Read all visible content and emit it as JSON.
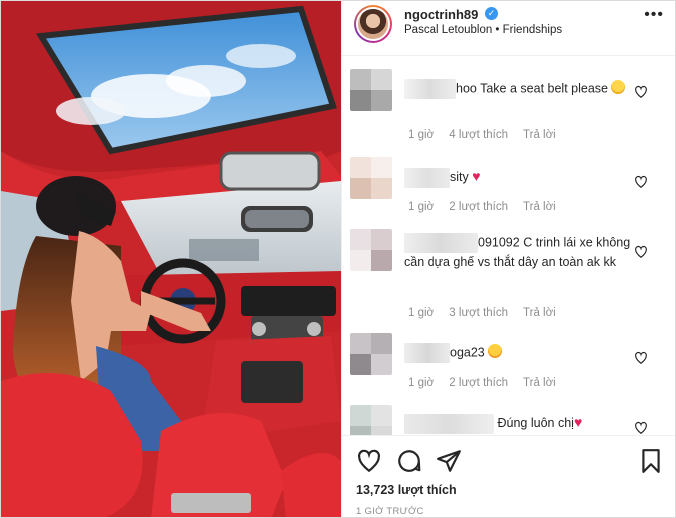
{
  "post": {
    "username": "ngoctrinh89",
    "verified_mark": "✓",
    "music": "Pascal Letoublon • Friendships",
    "more_label": "•••",
    "likes": "13,723 lượt thích",
    "time": "1 GIỜ TRƯỚC"
  },
  "comments": [
    {
      "name_suffix": "hoo",
      "text": "Take a seat belt please",
      "emoji": "smirk-emoji",
      "time": "1 giờ",
      "likes": "4 lượt thích",
      "reply": "Trả lời"
    },
    {
      "name_suffix": "sity",
      "text": "",
      "emoji": "red-heart-emoji",
      "time": "1 giờ",
      "likes": "2 lượt thích",
      "reply": "Trả lời"
    },
    {
      "name_suffix": "091092",
      "text": "C trinh lái xe không cần dựa ghế vs thắt dây an toàn ak kk",
      "emoji": "",
      "time": "1 giờ",
      "likes": "3 lượt thích",
      "reply": "Trả lời"
    },
    {
      "name_suffix": "oga23",
      "text": "",
      "emoji": "star-struck-emoji",
      "time": "1 giờ",
      "likes": "2 lượt thích",
      "reply": "Trả lời"
    },
    {
      "name_suffix": "",
      "text": "Đúng luôn chị",
      "emoji": "red-heart-emoji",
      "time": "",
      "likes": "",
      "reply": ""
    }
  ],
  "icons": {
    "like": "heart-icon",
    "comment": "comment-icon",
    "share": "paper-plane-icon",
    "save": "bookmark-icon"
  },
  "colors": {
    "interior_red": "#d72b31",
    "verified_blue": "#3897f0",
    "muted_text": "#8e8e8e",
    "heart_red": "#ed4956"
  }
}
